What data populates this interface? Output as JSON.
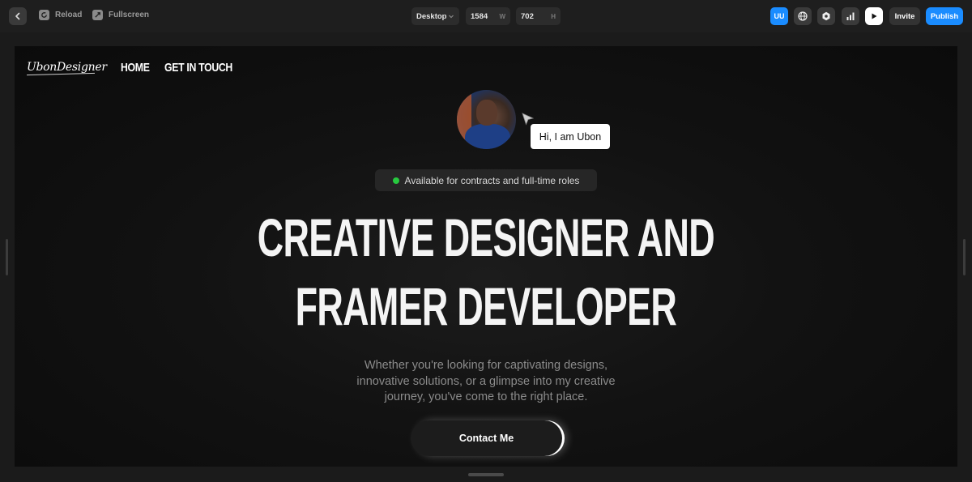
{
  "toolbar": {
    "reload_label": "Reload",
    "fullscreen_label": "Fullscreen",
    "device": "Desktop",
    "width_value": "1584",
    "width_unit": "W",
    "height_value": "702",
    "height_unit": "H",
    "user_initials": "UU",
    "invite_label": "Invite",
    "publish_label": "Publish"
  },
  "site": {
    "logo": "UbonDesigner",
    "nav": [
      "HOME",
      "GET IN TOUCH"
    ],
    "greeting": "Hi, I am Ubon",
    "availability": "Available for contracts and full-time roles",
    "headline_line1": "CREATIVE DESIGNER AND",
    "headline_line2": "FRAMER DEVELOPER",
    "subtitle": "Whether you're looking for captivating designs, innovative solutions, or a glimpse into my creative journey, you've come to the right place.",
    "cta_label": "Contact Me"
  },
  "colors": {
    "accent": "#1a8cff",
    "status_dot": "#27c93f",
    "background": "#0b0b0b"
  },
  "icons": [
    "chevron-left-icon",
    "reload-icon",
    "fullscreen-icon",
    "chevron-down-icon",
    "globe-icon",
    "settings-icon",
    "analytics-icon",
    "play-icon",
    "cursor-icon"
  ]
}
